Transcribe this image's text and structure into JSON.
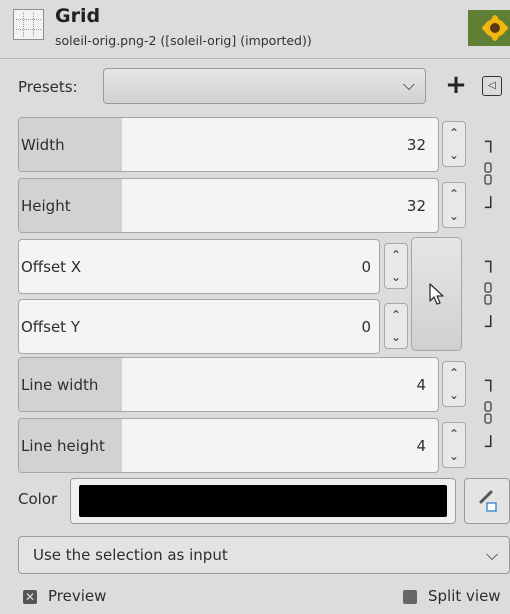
{
  "header": {
    "title": "Grid",
    "subtitle": "soleil-orig.png-2 ([soleil-orig] (imported))"
  },
  "presets": {
    "label": "Presets:",
    "value": "",
    "add_icon": "plus-icon",
    "menu_icon": "triangle-left-icon"
  },
  "fields": {
    "width": {
      "label": "Width",
      "value": "32"
    },
    "height": {
      "label": "Height",
      "value": "32"
    },
    "offset_x": {
      "label": "Offset X",
      "value": "0"
    },
    "offset_y": {
      "label": "Offset Y",
      "value": "0"
    },
    "line_width": {
      "label": "Line width",
      "value": "4"
    },
    "line_height": {
      "label": "Line height",
      "value": "4"
    }
  },
  "color": {
    "label": "Color",
    "swatch": "#000000",
    "picker_icon": "color-picker-icon"
  },
  "selection_mode": {
    "value": "Use the selection as input"
  },
  "footer": {
    "preview_label": "Preview",
    "preview_checked": true,
    "split_view_label": "Split view"
  }
}
